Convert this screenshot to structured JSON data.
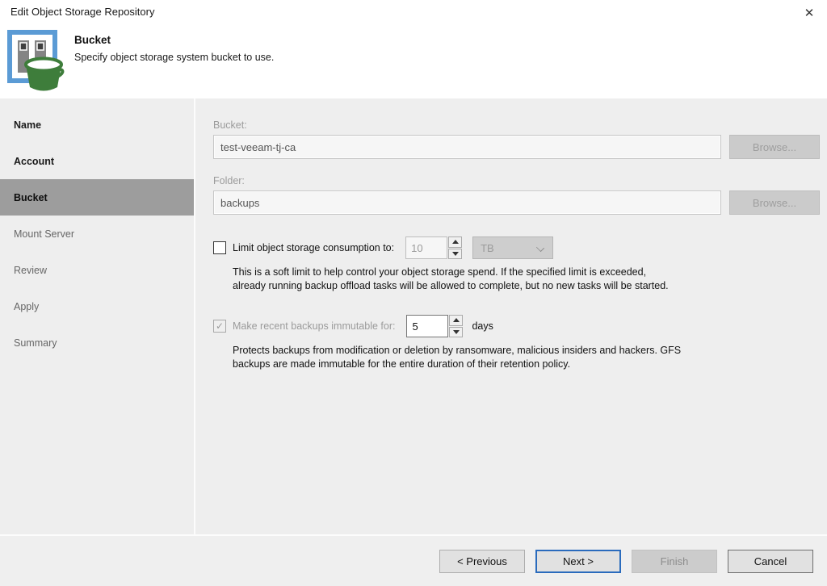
{
  "window": {
    "title": "Edit Object Storage Repository"
  },
  "icons": {
    "close": "✕",
    "check": "✓"
  },
  "header": {
    "title": "Bucket",
    "subtitle": "Specify object storage system bucket to use."
  },
  "sidebar": {
    "items": [
      {
        "label": "Name",
        "state": "done"
      },
      {
        "label": "Account",
        "state": "done"
      },
      {
        "label": "Bucket",
        "state": "current"
      },
      {
        "label": "Mount Server",
        "state": "todo"
      },
      {
        "label": "Review",
        "state": "todo"
      },
      {
        "label": "Apply",
        "state": "todo"
      },
      {
        "label": "Summary",
        "state": "todo"
      }
    ]
  },
  "main": {
    "bucket": {
      "label": "Bucket:",
      "value": "test-veeam-tj-ca",
      "browse_label": "Browse..."
    },
    "folder": {
      "label": "Folder:",
      "value": "backups",
      "browse_label": "Browse..."
    },
    "limit": {
      "label": "Limit object storage consumption to:",
      "checked": false,
      "value": "10",
      "unit": "TB",
      "desc_line1": "This is a soft limit to help control your object storage spend. If the specified limit is exceeded,",
      "desc_line2": "already running backup offload tasks will be allowed to complete, but no new tasks will be started."
    },
    "immutable": {
      "label": "Make recent backups immutable for:",
      "checked": true,
      "value": "5",
      "unit": "days",
      "desc_line1": "Protects backups from modification or deletion by ransomware, malicious insiders and hackers. GFS",
      "desc_line2": "backups are made immutable for the entire duration of their retention policy."
    }
  },
  "footer": {
    "previous_label": "< Previous",
    "next_label": "Next >",
    "finish_label": "Finish",
    "cancel_label": "Cancel"
  },
  "colors": {
    "accent_blue": "#2a6bbd",
    "icon_blue": "#5b9bd5",
    "bucket_green": "#3e7d3b",
    "selected_step_gray": "#9d9d9d"
  }
}
